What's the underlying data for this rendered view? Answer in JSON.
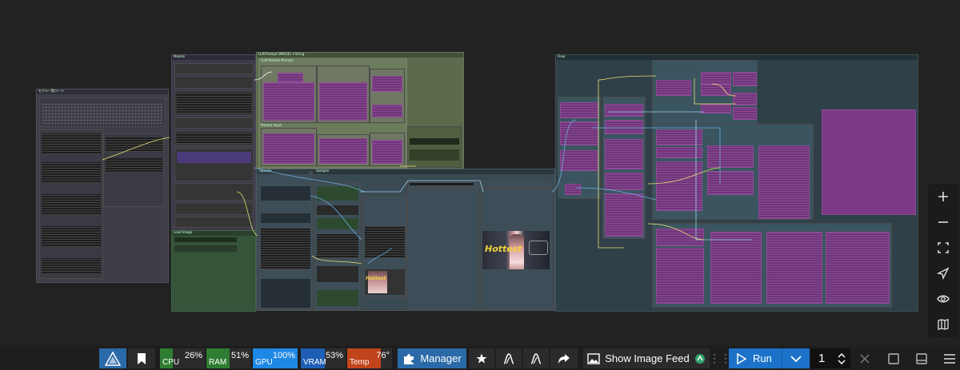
{
  "canvas": {
    "group_titles": [
      "モデル一覧ロード",
      "Models",
      "LLM Prompt (IMAGE) +String",
      "LLM Positive Prompt",
      "Prompt Input",
      "Flow"
    ],
    "node_titles": [
      "Load Image",
      "Sampler",
      "Upscale"
    ],
    "preview_text": "Hottest"
  },
  "zoom_controls": [
    "zoom-in",
    "zoom-out",
    "fit-view",
    "select-mode",
    "toggle-visibility",
    "minimap"
  ],
  "bottom_bar": {
    "monitors": [
      {
        "label": "CPU",
        "value": "26%",
        "color": "#2e7d32",
        "level": 0.26
      },
      {
        "label": "RAM",
        "value": "51%",
        "color": "#2e7d32",
        "level": 0.51
      },
      {
        "label": "GPU",
        "value": "100%",
        "color": "#1e88e5",
        "level": 1.0
      },
      {
        "label": "VRAM",
        "value": "53%",
        "color": "#1e5fb5",
        "level": 0.53
      },
      {
        "label": "Temp",
        "value": "76°",
        "color": "#c2441c",
        "level": 0.76
      }
    ],
    "manager_label": "Manager",
    "show_image_feed_label": "Show Image Feed",
    "run_label": "Run",
    "batch_count": "1",
    "colors": {
      "manager_bg": "#2b6aa8",
      "run_bg": "#1c72c9",
      "panel_bg": "#2b2b2b"
    }
  }
}
